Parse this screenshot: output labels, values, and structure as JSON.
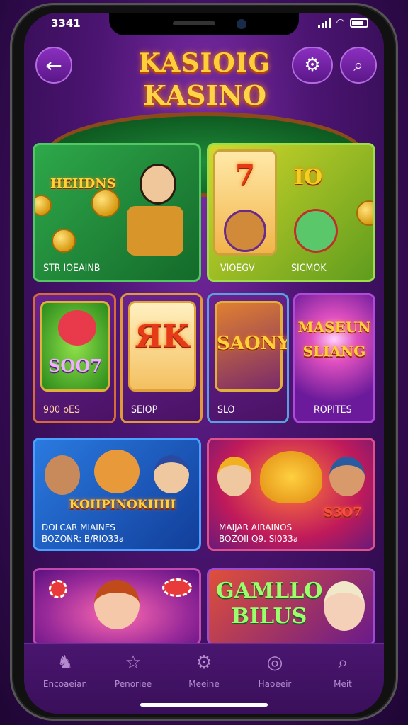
{
  "status_bar": {
    "time": "3341"
  },
  "header": {
    "logo_line1": "KASIOIG",
    "logo_line2": "KASINO"
  },
  "featured": [
    {
      "title": "HEIIDNS",
      "label": "STR IOEAINB"
    },
    {
      "title": "IO",
      "label": "VIOEGV",
      "label2": "SICMOK"
    }
  ],
  "games": [
    {
      "title": "SOO7",
      "label": "900 ɒES"
    },
    {
      "title": "ЯK",
      "label": "SEIOP"
    },
    {
      "title": "SAONY",
      "label": "SLO"
    },
    {
      "title": "MASEUN SLIANG",
      "label": "ROPITES"
    }
  ],
  "banners": [
    {
      "title": "KOIIPINOKIIIII",
      "line1": "DOLCAR MIAINES",
      "line2": "BOZONR: B/RIO33a"
    },
    {
      "title": "S3O7",
      "line1": "MAIJAR AIRAINOS",
      "line2": "BOZOII Q9. SI033a"
    }
  ],
  "promos": [
    {
      "title": ""
    },
    {
      "title": "GAMLLO BILUS"
    }
  ],
  "tabs": [
    {
      "icon": "dog-icon",
      "label": "Encoaeian"
    },
    {
      "icon": "star-icon",
      "label": "Penoriee"
    },
    {
      "icon": "gear-icon",
      "label": "Meeine"
    },
    {
      "icon": "chip-icon",
      "label": "Haoeeir"
    },
    {
      "icon": "search-icon",
      "label": "Meit"
    }
  ],
  "colors": {
    "accent": "#ffd23a",
    "panel": "#4a1266",
    "green": "#2ea84a"
  }
}
